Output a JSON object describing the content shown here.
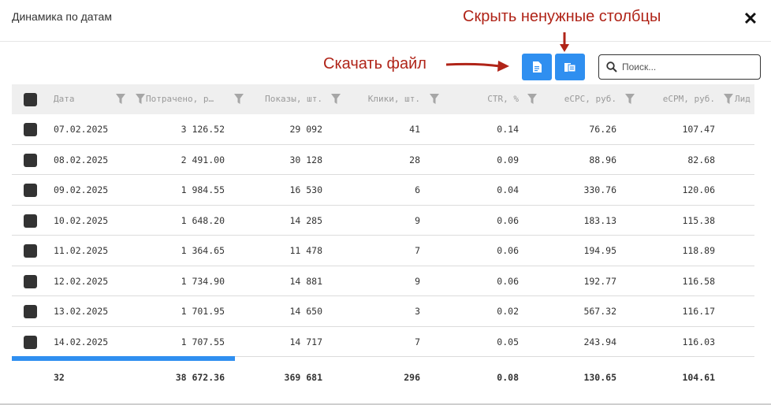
{
  "modal": {
    "title": "Динамика по датам",
    "close_symbol": "✕"
  },
  "annotations": {
    "hide_columns": "Скрыть ненужные столбцы",
    "download_file": "Скачать файл"
  },
  "toolbar": {
    "download_icon": "file-download-icon",
    "columns_icon": "columns-toggle-icon",
    "search_placeholder": "Поиск..."
  },
  "colors": {
    "accent": "#2f8ff0",
    "annotation": "#b02418",
    "checkbox": "#333333",
    "header_bg": "#efefef"
  },
  "table": {
    "columns": [
      "Дата",
      "Потрачено, р…",
      "Показы, шт.",
      "Клики, шт.",
      "CTR, %",
      "eCPC, руб.",
      "eCPM, руб.",
      "Лид"
    ],
    "rows": [
      [
        "07.02.2025",
        "3 126.52",
        "29 092",
        "41",
        "0.14",
        "76.26",
        "107.47"
      ],
      [
        "08.02.2025",
        "2 491.00",
        "30 128",
        "28",
        "0.09",
        "88.96",
        "82.68"
      ],
      [
        "09.02.2025",
        "1 984.55",
        "16 530",
        "6",
        "0.04",
        "330.76",
        "120.06"
      ],
      [
        "10.02.2025",
        "1 648.20",
        "14 285",
        "9",
        "0.06",
        "183.13",
        "115.38"
      ],
      [
        "11.02.2025",
        "1 364.65",
        "11 478",
        "7",
        "0.06",
        "194.95",
        "118.89"
      ],
      [
        "12.02.2025",
        "1 734.90",
        "14 881",
        "9",
        "0.06",
        "192.77",
        "116.58"
      ],
      [
        "13.02.2025",
        "1 701.95",
        "14 650",
        "3",
        "0.02",
        "567.32",
        "116.17"
      ],
      [
        "14.02.2025",
        "1 707.55",
        "14 717",
        "7",
        "0.05",
        "243.94",
        "116.03"
      ]
    ],
    "totals": [
      "32",
      "38 672.36",
      "369 681",
      "296",
      "0.08",
      "130.65",
      "104.61"
    ]
  }
}
